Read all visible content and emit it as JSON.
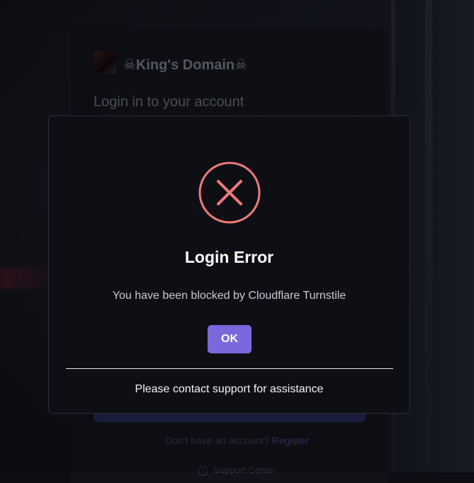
{
  "background_page": {
    "brand_title": "☠King's Domain☠",
    "login_subtitle": "Login in to your account",
    "register_prompt": "Don't have an account?",
    "register_link": "Register",
    "support_label": "Support Center"
  },
  "modal": {
    "icon": "x-circle-icon",
    "title": "Login Error",
    "message": "You have been blocked by Cloudflare Turnstile",
    "ok_label": "OK",
    "footer": "Please contact support for assistance"
  },
  "colors": {
    "accent": "#7b68dc",
    "error": "#f0797a",
    "modal_bg": "#0e0f15"
  }
}
